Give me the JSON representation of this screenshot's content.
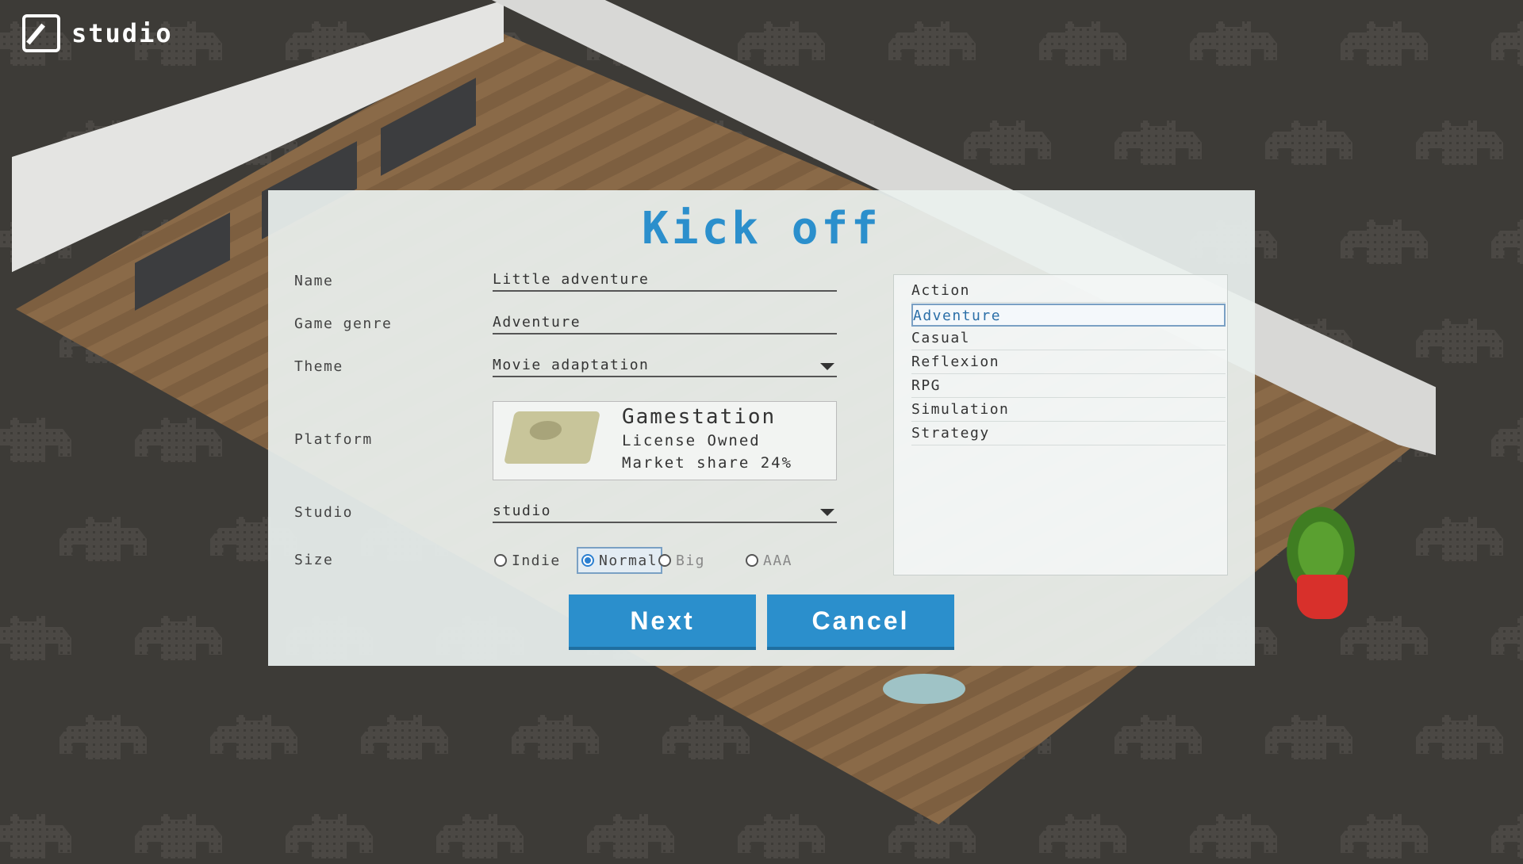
{
  "app": {
    "logo_text": "studio"
  },
  "dialog": {
    "title": "Kick off",
    "fields": {
      "name_label": "Name",
      "name_value": "Little adventure",
      "genre_label": "Game genre",
      "genre_value": "Adventure",
      "theme_label": "Theme",
      "theme_value": "Movie adaptation",
      "platform_label": "Platform",
      "studio_label": "Studio",
      "studio_value": "studio",
      "size_label": "Size"
    },
    "platform": {
      "name": "Gamestation",
      "license": "License Owned",
      "market_share": "Market share 24%"
    },
    "size_options": [
      {
        "label": "Indie",
        "selected": false
      },
      {
        "label": "Normal",
        "selected": true
      },
      {
        "label": "Big",
        "selected": false
      },
      {
        "label": "AAA",
        "selected": false
      }
    ],
    "genres": [
      "Action",
      "Adventure",
      "Casual",
      "Reflexion",
      "RPG",
      "Simulation",
      "Strategy"
    ],
    "selected_genre": "Adventure",
    "buttons": {
      "next": "Next",
      "cancel": "Cancel"
    }
  },
  "colors": {
    "accent": "#2b8fcc",
    "dialog_bg": "#e9f0ee",
    "background": "#3d3b37"
  }
}
